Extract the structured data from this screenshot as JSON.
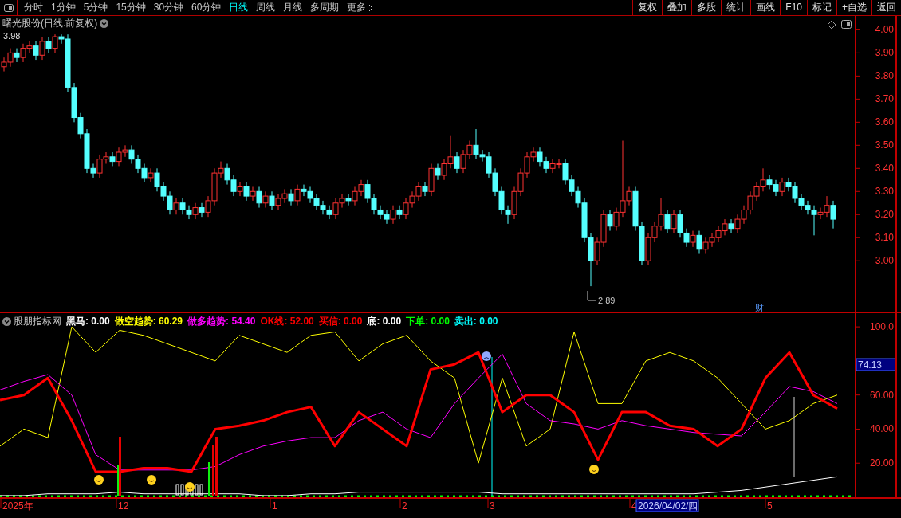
{
  "toolbar": {
    "periods": [
      {
        "label": "分时",
        "selected": false
      },
      {
        "label": "1分钟",
        "selected": false
      },
      {
        "label": "5分钟",
        "selected": false
      },
      {
        "label": "15分钟",
        "selected": false
      },
      {
        "label": "30分钟",
        "selected": false
      },
      {
        "label": "60分钟",
        "selected": false
      },
      {
        "label": "日线",
        "selected": true
      },
      {
        "label": "周线",
        "selected": false
      },
      {
        "label": "月线",
        "selected": false
      },
      {
        "label": "多周期",
        "selected": false
      }
    ],
    "more": "更多",
    "buttons": [
      "复权",
      "叠加",
      "多股",
      "统计",
      "画线",
      "F10",
      "标记",
      "+自选",
      "返回"
    ]
  },
  "price_panel": {
    "title": "曙光股份(日线.前复权)",
    "high_label": "3.98",
    "low_label": "2.89",
    "event_tag": "财",
    "chart_data": {
      "type": "candlestick",
      "ylim": [
        2.78,
        4.06
      ],
      "yticks": [
        {
          "value": 4.0,
          "label": "4.00"
        },
        {
          "value": 3.9,
          "label": "3.90"
        },
        {
          "value": 3.8,
          "label": "3.80"
        },
        {
          "value": 3.7,
          "label": "3.70"
        },
        {
          "value": 3.6,
          "label": "3.60"
        },
        {
          "value": 3.5,
          "label": "3.50"
        },
        {
          "value": 3.4,
          "label": "3.40"
        },
        {
          "value": 3.3,
          "label": "3.30"
        },
        {
          "value": 3.2,
          "label": "3.20"
        },
        {
          "value": 3.1,
          "label": "3.10"
        },
        {
          "value": 3.0,
          "label": "3.00"
        }
      ],
      "ohlc": [
        [
          3.84,
          3.88,
          3.82,
          3.86
        ],
        [
          3.86,
          3.92,
          3.84,
          3.9
        ],
        [
          3.9,
          3.92,
          3.86,
          3.88
        ],
        [
          3.88,
          3.94,
          3.86,
          3.92
        ],
        [
          3.92,
          3.95,
          3.9,
          3.93
        ],
        [
          3.93,
          3.95,
          3.87,
          3.89
        ],
        [
          3.89,
          3.97,
          3.87,
          3.95
        ],
        [
          3.95,
          3.97,
          3.9,
          3.92
        ],
        [
          3.92,
          3.98,
          3.9,
          3.97
        ],
        [
          3.97,
          3.98,
          3.94,
          3.96
        ],
        [
          3.96,
          3.98,
          3.73,
          3.75
        ],
        [
          3.75,
          3.77,
          3.6,
          3.62
        ],
        [
          3.62,
          3.64,
          3.53,
          3.55
        ],
        [
          3.55,
          3.57,
          3.38,
          3.4
        ],
        [
          3.4,
          3.42,
          3.36,
          3.38
        ],
        [
          3.38,
          3.46,
          3.36,
          3.44
        ],
        [
          3.44,
          3.47,
          3.42,
          3.45
        ],
        [
          3.45,
          3.47,
          3.41,
          3.43
        ],
        [
          3.43,
          3.49,
          3.41,
          3.47
        ],
        [
          3.47,
          3.5,
          3.45,
          3.48
        ],
        [
          3.48,
          3.5,
          3.42,
          3.44
        ],
        [
          3.44,
          3.46,
          3.38,
          3.4
        ],
        [
          3.4,
          3.42,
          3.34,
          3.36
        ],
        [
          3.36,
          3.4,
          3.34,
          3.38
        ],
        [
          3.38,
          3.4,
          3.3,
          3.32
        ],
        [
          3.32,
          3.34,
          3.26,
          3.28
        ],
        [
          3.28,
          3.3,
          3.2,
          3.22
        ],
        [
          3.22,
          3.27,
          3.2,
          3.25
        ],
        [
          3.25,
          3.27,
          3.2,
          3.22
        ],
        [
          3.22,
          3.24,
          3.18,
          3.2
        ],
        [
          3.2,
          3.25,
          3.18,
          3.23
        ],
        [
          3.23,
          3.25,
          3.19,
          3.21
        ],
        [
          3.21,
          3.28,
          3.19,
          3.26
        ],
        [
          3.26,
          3.4,
          3.24,
          3.38
        ],
        [
          3.38,
          3.43,
          3.36,
          3.4
        ],
        [
          3.4,
          3.42,
          3.33,
          3.35
        ],
        [
          3.35,
          3.37,
          3.28,
          3.3
        ],
        [
          3.3,
          3.34,
          3.28,
          3.32
        ],
        [
          3.32,
          3.34,
          3.26,
          3.28
        ],
        [
          3.28,
          3.32,
          3.26,
          3.3
        ],
        [
          3.3,
          3.32,
          3.23,
          3.25
        ],
        [
          3.25,
          3.3,
          3.23,
          3.28
        ],
        [
          3.28,
          3.3,
          3.22,
          3.24
        ],
        [
          3.24,
          3.29,
          3.22,
          3.27
        ],
        [
          3.27,
          3.31,
          3.25,
          3.29
        ],
        [
          3.29,
          3.31,
          3.24,
          3.26
        ],
        [
          3.26,
          3.33,
          3.24,
          3.31
        ],
        [
          3.31,
          3.33,
          3.28,
          3.3
        ],
        [
          3.3,
          3.32,
          3.25,
          3.27
        ],
        [
          3.27,
          3.29,
          3.22,
          3.24
        ],
        [
          3.24,
          3.26,
          3.2,
          3.22
        ],
        [
          3.22,
          3.24,
          3.18,
          3.2
        ],
        [
          3.2,
          3.27,
          3.18,
          3.25
        ],
        [
          3.25,
          3.29,
          3.23,
          3.27
        ],
        [
          3.27,
          3.29,
          3.24,
          3.26
        ],
        [
          3.26,
          3.32,
          3.24,
          3.3
        ],
        [
          3.3,
          3.35,
          3.28,
          3.33
        ],
        [
          3.33,
          3.35,
          3.25,
          3.27
        ],
        [
          3.27,
          3.29,
          3.2,
          3.22
        ],
        [
          3.22,
          3.24,
          3.18,
          3.2
        ],
        [
          3.2,
          3.22,
          3.16,
          3.18
        ],
        [
          3.18,
          3.24,
          3.16,
          3.22
        ],
        [
          3.22,
          3.24,
          3.18,
          3.2
        ],
        [
          3.2,
          3.27,
          3.18,
          3.25
        ],
        [
          3.25,
          3.3,
          3.23,
          3.28
        ],
        [
          3.28,
          3.34,
          3.26,
          3.32
        ],
        [
          3.32,
          3.34,
          3.28,
          3.3
        ],
        [
          3.3,
          3.42,
          3.28,
          3.4
        ],
        [
          3.4,
          3.42,
          3.35,
          3.37
        ],
        [
          3.37,
          3.44,
          3.35,
          3.42
        ],
        [
          3.42,
          3.54,
          3.4,
          3.45
        ],
        [
          3.45,
          3.47,
          3.38,
          3.4
        ],
        [
          3.4,
          3.48,
          3.38,
          3.46
        ],
        [
          3.46,
          3.52,
          3.44,
          3.5
        ],
        [
          3.5,
          3.57,
          3.44,
          3.46
        ],
        [
          3.46,
          3.48,
          3.43,
          3.45
        ],
        [
          3.45,
          3.47,
          3.36,
          3.38
        ],
        [
          3.38,
          3.4,
          3.28,
          3.3
        ],
        [
          3.3,
          3.32,
          3.2,
          3.22
        ],
        [
          3.22,
          3.24,
          3.16,
          3.2
        ],
        [
          3.2,
          3.32,
          3.18,
          3.3
        ],
        [
          3.3,
          3.4,
          3.28,
          3.38
        ],
        [
          3.38,
          3.47,
          3.36,
          3.45
        ],
        [
          3.45,
          3.49,
          3.43,
          3.47
        ],
        [
          3.47,
          3.49,
          3.41,
          3.43
        ],
        [
          3.43,
          3.45,
          3.38,
          3.4
        ],
        [
          3.4,
          3.44,
          3.38,
          3.42
        ],
        [
          3.42,
          3.44,
          3.4,
          3.42
        ],
        [
          3.42,
          3.44,
          3.33,
          3.35
        ],
        [
          3.35,
          3.37,
          3.28,
          3.3
        ],
        [
          3.3,
          3.32,
          3.23,
          3.25
        ],
        [
          3.25,
          3.27,
          3.08,
          3.1
        ],
        [
          3.1,
          3.12,
          2.89,
          3.0
        ],
        [
          3.0,
          3.1,
          2.98,
          3.08
        ],
        [
          3.08,
          3.22,
          3.06,
          3.2
        ],
        [
          3.2,
          3.22,
          3.13,
          3.15
        ],
        [
          3.15,
          3.23,
          3.13,
          3.21
        ],
        [
          3.21,
          3.52,
          3.19,
          3.26
        ],
        [
          3.26,
          3.32,
          3.24,
          3.3
        ],
        [
          3.3,
          3.32,
          3.13,
          3.15
        ],
        [
          3.15,
          3.17,
          2.98,
          3.0
        ],
        [
          3.0,
          3.12,
          2.98,
          3.1
        ],
        [
          3.1,
          3.17,
          3.08,
          3.15
        ],
        [
          3.15,
          3.27,
          3.13,
          3.2
        ],
        [
          3.2,
          3.22,
          3.12,
          3.14
        ],
        [
          3.14,
          3.22,
          3.12,
          3.2
        ],
        [
          3.2,
          3.22,
          3.1,
          3.12
        ],
        [
          3.12,
          3.14,
          3.06,
          3.08
        ],
        [
          3.08,
          3.13,
          3.06,
          3.11
        ],
        [
          3.11,
          3.13,
          3.03,
          3.05
        ],
        [
          3.05,
          3.1,
          3.03,
          3.08
        ],
        [
          3.08,
          3.12,
          3.06,
          3.1
        ],
        [
          3.1,
          3.15,
          3.08,
          3.13
        ],
        [
          3.13,
          3.18,
          3.11,
          3.16
        ],
        [
          3.16,
          3.18,
          3.12,
          3.14
        ],
        [
          3.14,
          3.2,
          3.12,
          3.18
        ],
        [
          3.18,
          3.24,
          3.16,
          3.22
        ],
        [
          3.22,
          3.3,
          3.2,
          3.28
        ],
        [
          3.28,
          3.34,
          3.26,
          3.32
        ],
        [
          3.32,
          3.4,
          3.3,
          3.35
        ],
        [
          3.35,
          3.37,
          3.31,
          3.33
        ],
        [
          3.33,
          3.35,
          3.28,
          3.3
        ],
        [
          3.3,
          3.36,
          3.28,
          3.34
        ],
        [
          3.34,
          3.36,
          3.3,
          3.32
        ],
        [
          3.32,
          3.34,
          3.25,
          3.27
        ],
        [
          3.27,
          3.29,
          3.22,
          3.24
        ],
        [
          3.24,
          3.26,
          3.2,
          3.22
        ],
        [
          3.22,
          3.24,
          3.11,
          3.2
        ],
        [
          3.2,
          3.23,
          3.18,
          3.21
        ],
        [
          3.21,
          3.28,
          3.19,
          3.24
        ],
        [
          3.24,
          3.26,
          3.14,
          3.18
        ]
      ]
    }
  },
  "indicator_panel": {
    "name": "股朋指标网",
    "legend_readings": [
      ": 0.00",
      ": 60.29",
      ": 54.40",
      ": 52.00"
    ],
    "legend_after": [
      {
        "label": "买信",
        "value": ": 0.00",
        "color": "#ff0000"
      },
      {
        "label": "底",
        "value": ": 0.00",
        "color": "#ffffff"
      },
      {
        "label": "下单",
        "value": ": 0.00",
        "color": "#00ff00"
      },
      {
        "label": "卖出",
        "value": ": 0.00",
        "color": "#00ffff"
      }
    ],
    "cursor_value": "74.13",
    "chart_data": {
      "type": "line",
      "ylim": [
        0,
        108
      ],
      "yticks": [
        {
          "value": 100,
          "label": "100.0"
        },
        {
          "value": 60,
          "label": "60.00"
        },
        {
          "value": 40,
          "label": "40.00"
        },
        {
          "value": 20,
          "label": "20.00"
        }
      ],
      "series": [
        {
          "name": "黑马",
          "color": "#ffffff",
          "values": [
            1,
            1,
            2,
            2,
            2,
            3,
            2,
            2,
            2,
            2,
            2,
            1,
            1,
            2,
            2,
            3,
            3,
            3,
            3,
            3,
            3,
            2,
            2,
            2,
            2,
            2,
            2,
            2,
            2,
            2,
            3,
            4,
            6,
            8,
            10,
            12
          ]
        },
        {
          "name": "做空趋势",
          "color": "#ffff00",
          "values": [
            30,
            40,
            35,
            100,
            85,
            98,
            95,
            90,
            85,
            80,
            95,
            90,
            85,
            95,
            97,
            80,
            90,
            95,
            80,
            70,
            20,
            70,
            30,
            40,
            97,
            55,
            55,
            80,
            85,
            80,
            70,
            55,
            40,
            45,
            55,
            60
          ]
        },
        {
          "name": "做多趋势",
          "color": "#ff00ff",
          "values": [
            63,
            68,
            72,
            60,
            25,
            16,
            16,
            16,
            16,
            18,
            25,
            30,
            33,
            35,
            35,
            45,
            50,
            40,
            35,
            55,
            70,
            84,
            55,
            45,
            43,
            40,
            45,
            42,
            40,
            38,
            37,
            36,
            50,
            65,
            62,
            55
          ]
        },
        {
          "name": "OK线",
          "color": "#ff0000",
          "values": [
            57,
            60,
            70,
            45,
            15,
            15,
            17,
            17,
            15,
            40,
            42,
            45,
            50,
            53,
            30,
            50,
            40,
            30,
            75,
            78,
            85,
            50,
            60,
            60,
            50,
            22,
            50,
            50,
            42,
            40,
            30,
            40,
            70,
            85,
            60,
            52
          ]
        }
      ]
    }
  },
  "time_axis": {
    "labels": [
      "2025年",
      "12",
      "1",
      "2",
      "3",
      "4",
      "5"
    ],
    "cursor_date": "2026/04/02/四"
  }
}
